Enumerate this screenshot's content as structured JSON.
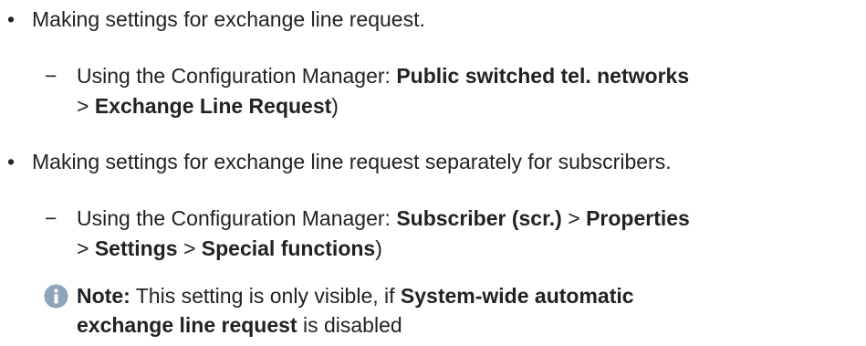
{
  "items": [
    {
      "bullet": "•",
      "text": "Making settings for exchange line request.",
      "sub": {
        "dash": "−",
        "prefix": "Using the Configuration Manager: ",
        "path1": "Public switched tel. networks",
        "sep1": "> ",
        "path2": "Exchange Line Request",
        "suffix": ")"
      }
    },
    {
      "bullet": "•",
      "text": "Making settings for exchange line request separately for subscribers.",
      "sub": {
        "dash": "−",
        "prefix": "Using the Configuration Manager: ",
        "path1": "Subscriber (scr.)",
        "sep1": " > ",
        "path2": "Properties",
        "sep2": "> ",
        "path3": "Settings",
        "sep3": " > ",
        "path4": "Special functions",
        "suffix": ")"
      }
    }
  ],
  "note": {
    "icon": "info-icon",
    "label": "Note:",
    "text1": " This setting is only visible, if ",
    "bold1": "System-wide automatic",
    "bold2": "exchange line request",
    "text2": " is disabled",
    "icon_color": "#8fa3bb"
  }
}
